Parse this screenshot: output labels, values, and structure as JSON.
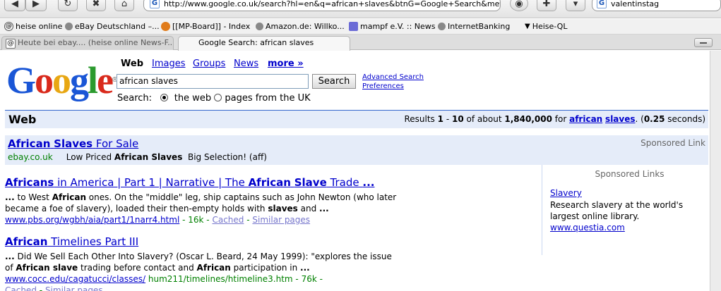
{
  "browser": {
    "url": "http://www.google.co.uk/search?hl=en&q=african+slaves&btnG=Google+Search&meta=",
    "search_value": "valentinstag"
  },
  "bookmarks": [
    {
      "label": "heise online"
    },
    {
      "label": "eBay Deutschland –..."
    },
    {
      "label": "[[MP-Board]] - Index"
    },
    {
      "label": "Amazon.de: Willko..."
    },
    {
      "label": "mampf e.V. :: News"
    },
    {
      "label": "InternetBanking"
    },
    {
      "label": "Heise-QL"
    }
  ],
  "tabs": [
    {
      "label": "Heute bei ebay.... (heise online News-F..."
    },
    {
      "label": "Google Search: african slaves"
    }
  ],
  "google": {
    "logo": "Google",
    "nav": {
      "current": "Web",
      "images": "Images",
      "groups": "Groups",
      "news": "News",
      "more": "more »"
    },
    "query": "african slaves",
    "search_button": "Search",
    "advanced": "Advanced Search",
    "preferences": "Preferences",
    "search_label": "Search:",
    "radio_web": "the web",
    "radio_uk": "pages from the UK"
  },
  "results_bar": {
    "title": "Web",
    "pre": "Results",
    "from": "1",
    "dash": "-",
    "to": "10",
    "of_about": "of about",
    "total": "1,840,000",
    "for": "for",
    "q1": "african",
    "q2": "slaves",
    "time_pre": ". (",
    "time": "0.25",
    "time_post": "seconds)"
  },
  "top_ad": {
    "t1": "African",
    "t2": "Slaves",
    "t3": "For Sale",
    "domain": "ebay.co.uk",
    "d1": "Low Priced",
    "d2": "African Slaves",
    "d3": "Big Selection! (aff)",
    "sponsored": "Sponsored Link"
  },
  "results": [
    {
      "title_parts": [
        "Africans",
        " in America | Part 1 | Narrative | The ",
        "African",
        " ",
        "Slave",
        " Trade ",
        "..."
      ],
      "snippet_parts": [
        "...",
        " to West ",
        "African",
        " ones. On the \"middle\" leg, ship captains such as John Newton (who later became a foe of slavery), loaded their then-empty holds with ",
        "slaves",
        " and ",
        "..."
      ],
      "url": "www.pbs.org/wgbh/aia/part1/1narr4.html",
      "size": "- 16k -",
      "cached": "Cached",
      "sep": "-",
      "similar": "Similar pages"
    },
    {
      "title_parts": [
        "African",
        " Timelines Part III"
      ],
      "snippet_parts": [
        "...",
        " Did We Sell Each Other Into Slavery? (Oscar L. Beard, 24 May 1999): \"explores the issue of ",
        "African slave",
        " trading before contact and ",
        "African",
        " participation in ",
        "..."
      ],
      "url": "www.cocc.edu/cagatucci/classes/",
      "url2": "hum211/timelines/htimeline3.htm",
      "size": "- 76k -",
      "cached": "Cached",
      "sep": "-",
      "similar": "Similar pages"
    }
  ],
  "side_ad": {
    "heading": "Sponsored Links",
    "title": "Slavery",
    "body": "Research slavery at the world's largest online library.",
    "url": "www.questia.com"
  },
  "colors": {
    "link": "#0000cc",
    "url_green": "#008000",
    "band": "#e5ecf9"
  }
}
